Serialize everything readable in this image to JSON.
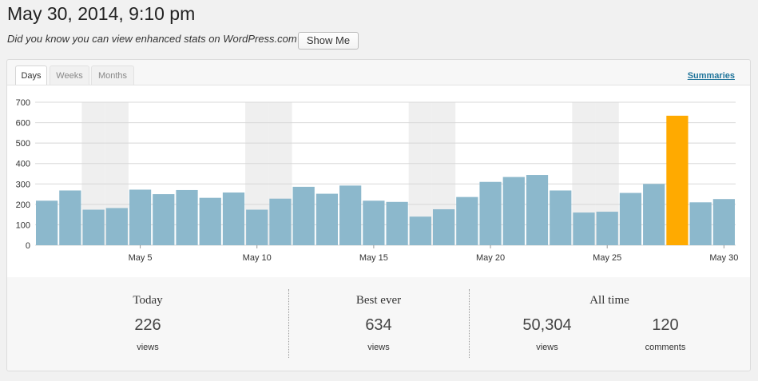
{
  "header": {
    "title": "May 30, 2014, 9:10 pm",
    "promo_text": "Did you know you can view enhanced stats on WordPress.com?",
    "show_me_label": "Show Me"
  },
  "tabs": [
    {
      "label": "Days",
      "active": true
    },
    {
      "label": "Weeks",
      "active": false
    },
    {
      "label": "Months",
      "active": false
    }
  ],
  "summaries_label": "Summaries",
  "chart_data": {
    "type": "bar",
    "ylim": [
      0,
      700
    ],
    "yticks": [
      0,
      100,
      200,
      300,
      400,
      500,
      600,
      700
    ],
    "grid": true,
    "categories": [
      "May 1",
      "May 2",
      "May 3",
      "May 4",
      "May 5",
      "May 6",
      "May 7",
      "May 8",
      "May 9",
      "May 10",
      "May 11",
      "May 12",
      "May 13",
      "May 14",
      "May 15",
      "May 16",
      "May 17",
      "May 18",
      "May 19",
      "May 20",
      "May 21",
      "May 22",
      "May 23",
      "May 24",
      "May 25",
      "May 26",
      "May 27",
      "May 28",
      "May 29",
      "May 30"
    ],
    "values": [
      218,
      268,
      174,
      182,
      272,
      250,
      270,
      232,
      258,
      174,
      228,
      286,
      252,
      292,
      218,
      212,
      140,
      176,
      236,
      310,
      334,
      344,
      268,
      160,
      164,
      256,
      300,
      634,
      210,
      226
    ],
    "x_tick_labels": [
      {
        "label": "May 5",
        "index": 4
      },
      {
        "label": "May 10",
        "index": 9
      },
      {
        "label": "May 15",
        "index": 14
      },
      {
        "label": "May 20",
        "index": 19
      },
      {
        "label": "May 25",
        "index": 24
      },
      {
        "label": "May 30",
        "index": 29
      }
    ],
    "weekend_indices": [
      2,
      3,
      9,
      10,
      16,
      17,
      23,
      24
    ],
    "highlight_index": 27,
    "colors": {
      "bar": "#8cb8cc",
      "highlight": "#ffaa00",
      "weekend": "#efefef",
      "grid": "#d8d8d8"
    }
  },
  "stats": {
    "today": {
      "title": "Today",
      "value": "226",
      "unit": "views"
    },
    "best_ever": {
      "title": "Best ever",
      "value": "634",
      "unit": "views"
    },
    "all_time": {
      "title": "All time",
      "views_value": "50,304",
      "views_unit": "views",
      "comments_value": "120",
      "comments_unit": "comments"
    }
  }
}
